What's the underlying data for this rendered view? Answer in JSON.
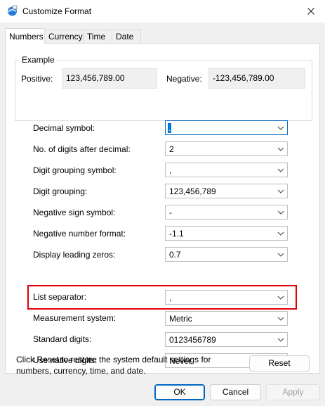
{
  "window": {
    "title": "Customize Format"
  },
  "tabs": [
    {
      "label": "Numbers",
      "active": true
    },
    {
      "label": "Currency",
      "active": false
    },
    {
      "label": "Time",
      "active": false
    },
    {
      "label": "Date",
      "active": false
    }
  ],
  "example": {
    "legend": "Example",
    "positive_label": "Positive:",
    "positive_value": "123,456,789.00",
    "negative_label": "Negative:",
    "negative_value": "-123,456,789.00"
  },
  "settings": [
    {
      "label": "Decimal symbol:",
      "value": "."
    },
    {
      "label": "No. of digits after decimal:",
      "value": "2"
    },
    {
      "label": "Digit grouping symbol:",
      "value": ","
    },
    {
      "label": "Digit grouping:",
      "value": "123,456,789"
    },
    {
      "label": "Negative sign symbol:",
      "value": "-"
    },
    {
      "label": "Negative number format:",
      "value": "-1.1"
    },
    {
      "label": "Display leading zeros:",
      "value": "0.7"
    },
    {
      "label": "List separator:",
      "value": ","
    },
    {
      "label": "Measurement system:",
      "value": "Metric"
    },
    {
      "label": "Standard digits:",
      "value": "0123456789"
    },
    {
      "label": "Use native digits:",
      "value": "Never"
    }
  ],
  "reset": {
    "text": "Click Reset to restore the system default settings for numbers, currency, time, and date.",
    "button_label": "Reset"
  },
  "buttons": {
    "ok": "OK",
    "cancel": "Cancel",
    "apply": "Apply"
  },
  "colors": {
    "accent": "#0067c0",
    "highlight": "#e0000a",
    "selection": "#0078d4"
  }
}
